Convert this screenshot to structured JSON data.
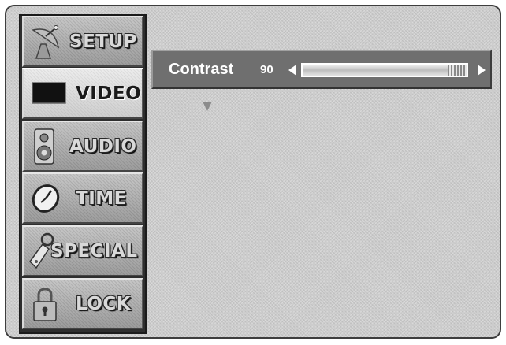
{
  "menu": {
    "items": [
      {
        "label": "SETUP",
        "icon": "satellite-dish-icon",
        "active": false
      },
      {
        "label": "VIDEO",
        "icon": "tv-screen-icon",
        "active": true
      },
      {
        "label": "AUDIO",
        "icon": "speaker-icon",
        "active": false
      },
      {
        "label": "TIME",
        "icon": "clock-icon",
        "active": false
      },
      {
        "label": "SPECIAL",
        "icon": "key-tag-icon",
        "active": false
      },
      {
        "label": "LOCK",
        "icon": "padlock-icon",
        "active": false
      }
    ]
  },
  "setting": {
    "name": "Contrast",
    "value": "90",
    "level_percent": 90
  },
  "colors": {
    "panel_background": "#6f6f6f",
    "text": "#ffffff",
    "screen_background": "#cdcdcd"
  }
}
